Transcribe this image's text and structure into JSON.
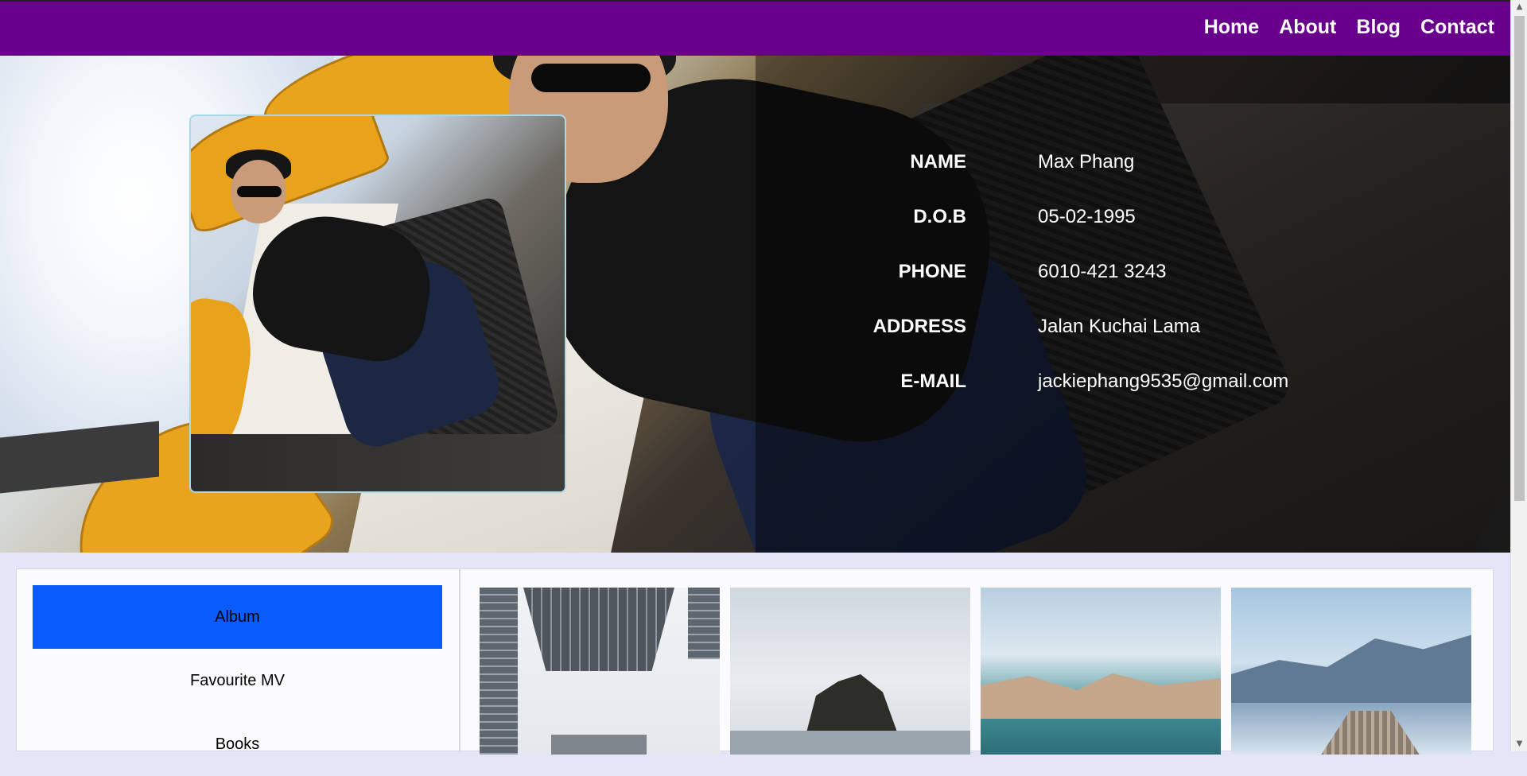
{
  "nav": {
    "items": [
      {
        "label": "Home"
      },
      {
        "label": "About"
      },
      {
        "label": "Blog"
      },
      {
        "label": "Contact"
      }
    ]
  },
  "profile": {
    "fields": [
      {
        "label": "NAME",
        "value": "Max Phang"
      },
      {
        "label": "D.O.B",
        "value": "05-02-1995"
      },
      {
        "label": "PHONE",
        "value": "6010-421 3243"
      },
      {
        "label": "ADDRESS",
        "value": "Jalan Kuchai Lama"
      },
      {
        "label": "E-MAIL",
        "value": "jackiephang9535@gmail.com"
      }
    ]
  },
  "sidebar": {
    "items": [
      {
        "label": "Album",
        "active": true
      },
      {
        "label": "Favourite MV",
        "active": false
      },
      {
        "label": "Books",
        "active": false
      }
    ]
  },
  "colors": {
    "nav_bg": "#68008c",
    "active_tab": "#0a5cff",
    "page_bg": "#e6e4f7"
  },
  "icons": {
    "scroll_up": "triangle-up-icon",
    "scroll_down": "triangle-down-icon"
  }
}
